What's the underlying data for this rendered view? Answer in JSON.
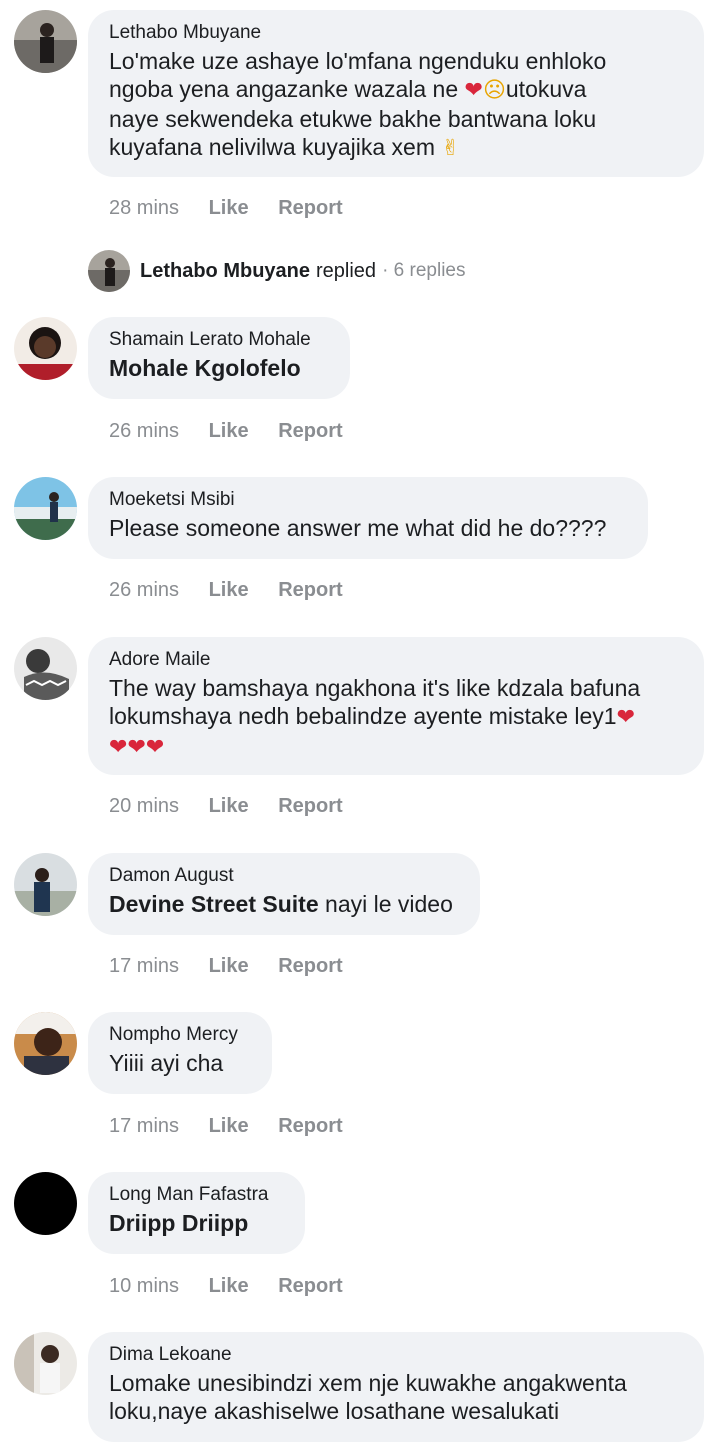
{
  "comments": [
    {
      "author": "Lethabo Mbuyane",
      "text_parts": [
        "Lo'make uze ashaye lo'mfana ngenduku enhloko",
        "ngoba yena angazanke wazala ne ",
        "utokuva",
        "naye sekwendeka etukwe bakhe bantwana loku",
        "kuyafana nelivilwa kuyajika xem "
      ],
      "time": "28 mins",
      "like": "Like",
      "report": "Report"
    },
    {
      "author": "Shamain Lerato Mohale",
      "tag": "Mohale Kgolofelo",
      "time": "26 mins",
      "like": "Like",
      "report": "Report"
    },
    {
      "author": "Moeketsi Msibi",
      "text": "Please someone answer me what did he do????",
      "time": "26 mins",
      "like": "Like",
      "report": "Report"
    },
    {
      "author": "Adore Maile",
      "text_line1": "The way bamshaya ngakhona it's like kdzala bafuna",
      "text_line2": "lokumshaya nedh bebalindze ayente mistake ley1",
      "time": "20 mins",
      "like": "Like",
      "report": "Report"
    },
    {
      "author": "Damon August",
      "tag": "Devine Street Suite",
      "text": " nayi le video",
      "time": "17 mins",
      "like": "Like",
      "report": "Report"
    },
    {
      "author": "Nompho Mercy",
      "text": "Yiiii ayi cha",
      "time": "17 mins",
      "like": "Like",
      "report": "Report"
    },
    {
      "author": "Long Man Fafastra",
      "tag": "Driipp Driipp",
      "time": "10 mins",
      "like": "Like",
      "report": "Report"
    },
    {
      "author": "Dima Lekoane",
      "text_line1": "Lomake unesibindzi xem nje kuwakhe angakwenta",
      "text_line2": "loku,naye akashiselwe losathane wesalukati"
    }
  ],
  "reply_summary": {
    "name": "Lethabo Mbuyane",
    "word": "replied",
    "count": "· 6 replies"
  },
  "icons": {
    "broken_heart": "broken-heart-emoji",
    "pleading_face": "pleading-face-emoji",
    "crossed_fingers": "crossed-fingers-emoji"
  },
  "colors": {
    "bubble": "#f0f2f5",
    "meta": "#8a8d91",
    "text": "#1c1e21"
  }
}
